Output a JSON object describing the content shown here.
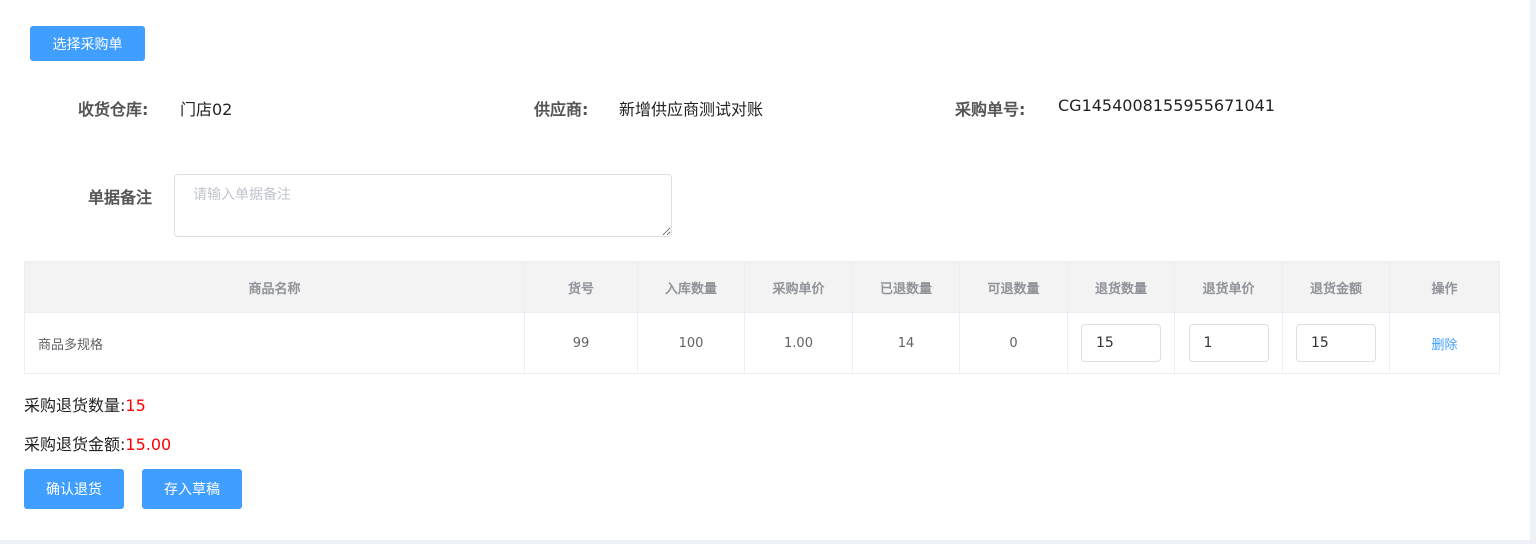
{
  "toolbar": {
    "select_order_label": "选择采购单"
  },
  "info": {
    "warehouse_label": "收货仓库:",
    "warehouse_value": "门店02",
    "supplier_label": "供应商:",
    "supplier_value": "新增供应商测试对账",
    "order_no_label": "采购单号:",
    "order_no_value": "CG1454008155955671041"
  },
  "remark": {
    "label": "单据备注",
    "placeholder": "请输入单据备注",
    "value": ""
  },
  "table": {
    "headers": [
      "商品名称",
      "货号",
      "入库数量",
      "采购单价",
      "已退数量",
      "可退数量",
      "退货数量",
      "退货单价",
      "退货金额",
      "操作"
    ],
    "rows": [
      {
        "name": "商品多规格",
        "sku": "99",
        "in_qty": "100",
        "unit_price": "1.00",
        "returned_qty": "14",
        "returnable_qty": "0",
        "return_qty": "15",
        "return_price": "1",
        "return_amount": "15",
        "action": "删除"
      }
    ]
  },
  "summary": {
    "qty_label": "采购退货数量:",
    "qty_value": "15",
    "amount_label": "采购退货金额:",
    "amount_value": "15.00"
  },
  "actions": {
    "confirm_label": "确认退货",
    "draft_label": "存入草稿"
  },
  "colors": {
    "primary": "#409eff",
    "highlight": "#ff0000",
    "header_bg": "#f3f3f3"
  }
}
